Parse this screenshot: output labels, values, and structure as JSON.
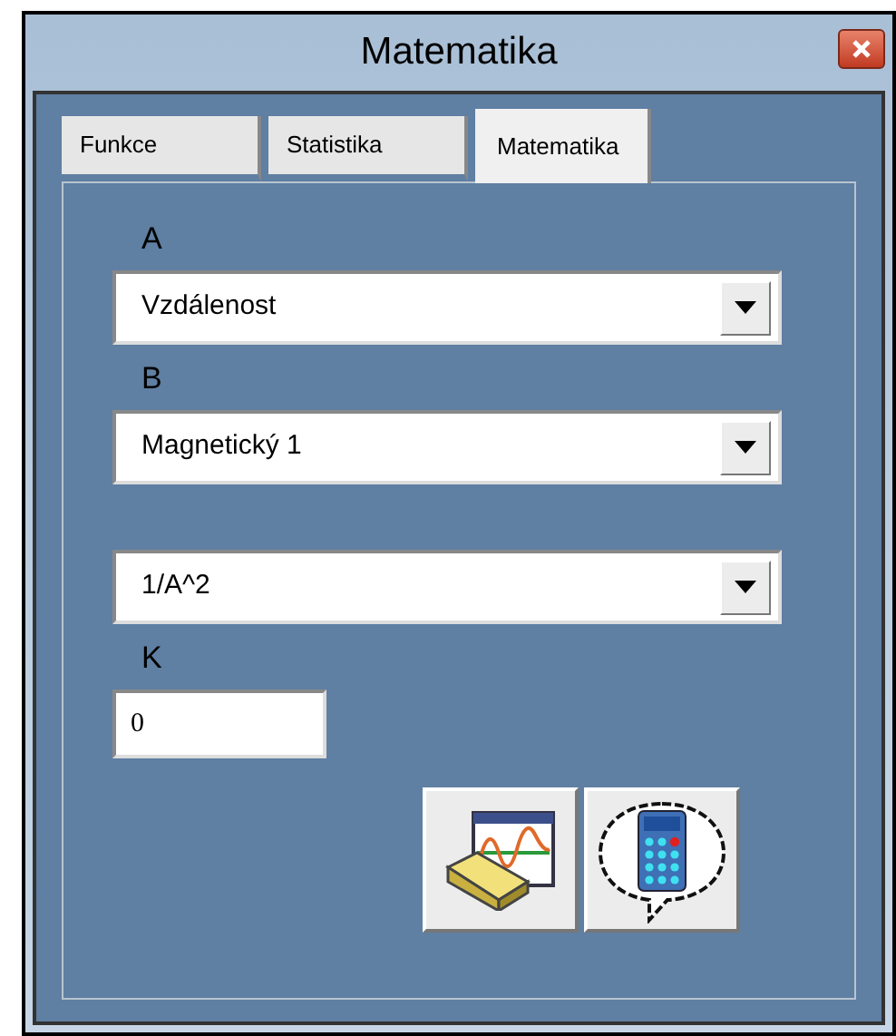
{
  "window": {
    "title": "Matematika"
  },
  "tabs": [
    {
      "label": "Funkce",
      "selected": false
    },
    {
      "label": "Statistika",
      "selected": false
    },
    {
      "label": "Matematika",
      "selected": true
    }
  ],
  "fields": [
    {
      "kind": "select",
      "label": "A",
      "value": "Vzdálenost"
    },
    {
      "kind": "select",
      "label": "B",
      "value": "Magnetický 1"
    },
    {
      "kind": "select",
      "value": "1/A^2"
    },
    {
      "kind": "input",
      "label": "K",
      "value": "0"
    }
  ]
}
